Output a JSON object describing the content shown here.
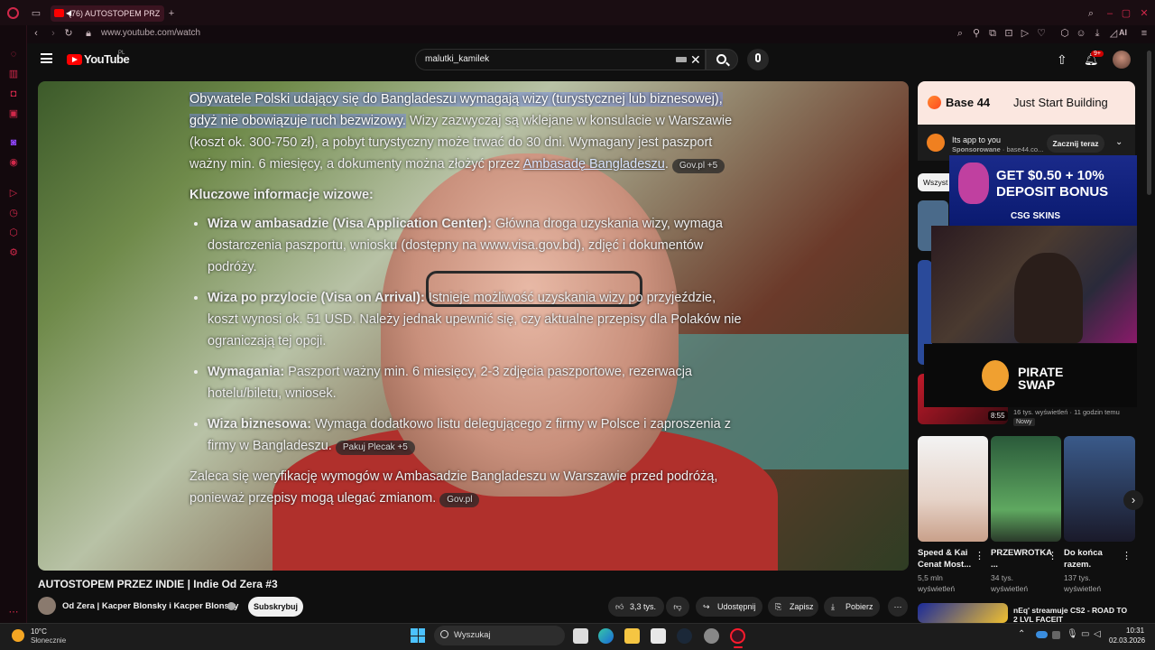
{
  "browser": {
    "tab_title": "(76) AUTOSTOPEM PRZ",
    "url": "www.youtube.com/watch",
    "ai_label": "AI"
  },
  "youtube": {
    "logo": "YouTube",
    "logo_country": "PL",
    "search_value": "malutki_kamilek",
    "notification_badge": "9+"
  },
  "video": {
    "overlay": {
      "intro_highlight": "Obywatele Polski udający się do Bangladeszu wymagają wizy (turystycznej lub biznesowej), gdyż nie obowiązuje ruch bezwizowy.",
      "intro_rest": " Wizy zazwyczaj są wklejane w konsulacie w Warszawie (koszt ok. 300-750 zł), a pobyt turystyczny może trwać do 30 dni. Wymagany jest paszport ważny min. 6 miesięcy, a dokumenty można złożyć przez ",
      "intro_link": "Ambasadę Bangladeszu",
      "intro_chip": "Gov.pl +5",
      "heading": "Kluczowe informacje wizowe:",
      "items": [
        {
          "title": "Wiza w ambasadzie (Visa Application Center):",
          "text": " Główna droga uzyskania wizy, wymaga dostarczenia paszportu, wniosku (dostępny na www.visa.gov.bd), zdjęć i dokumentów podróży.",
          "chip": ""
        },
        {
          "title": "Wiza po przylocie (Visa on Arrival):",
          "text": " Istnieje możliwość uzyskania wizy po przyjeździe, koszt wynosi ok. 51 USD. Należy jednak upewnić się, czy aktualne przepisy dla Polaków nie ograniczają tej opcji.",
          "chip": ""
        },
        {
          "title": "Wymagania:",
          "text": " Paszport ważny min. 6 miesięcy, 2-3 zdjęcia paszportowe, rezerwacja hotelu/biletu, wniosek.",
          "chip": ""
        },
        {
          "title": "Wiza biznesowa:",
          "text": " Wymaga dodatkowo listu delegującego z firmy w Polsce i zaproszenia z firmy w Bangladeszu.",
          "chip": "Pakuj Plecak +5"
        }
      ],
      "outro": "Zaleca się weryfikację wymogów w Ambasadzie Bangladeszu w Warszawie przed podróżą, ponieważ przepisy mogą ulegać zmianom.",
      "outro_chip": "Gov.pl"
    },
    "title": "AUTOSTOPEM PRZEZ INDIE | Indie Od Zera #3",
    "channel": "Od Zera | Kacper Blonsky i Kacper Blonsky",
    "subscribe_label": "Subskrybuj",
    "like_count": "3,3 tys.",
    "share_label": "Udostępnij",
    "save_label": "Zapisz",
    "download_label": "Pobierz"
  },
  "sidebar": {
    "ad": {
      "brand": "Base 44",
      "tagline": "Just Start Building",
      "line1": "Its app to you",
      "sponsored": "Sponsorowane",
      "domain": "base44.co...",
      "cta": "Zacznij teraz"
    },
    "chip_all": "Wszyst",
    "csg": {
      "line1": "GET $0.50 + 10%",
      "line2": "DEPOSIT BONUS",
      "brand": "CSG SKINS"
    },
    "pirate": "PIRATE SWAP",
    "video_meta": {
      "duration": "8:55",
      "views": "16 tys. wyświetleń · 11 godzin temu",
      "badge": "Nowy"
    },
    "shorts": [
      {
        "title": "Speed & Kai Cenat Most...",
        "views": "5,5 mln wyświetleń"
      },
      {
        "title": "PRZEWROTKA ...",
        "views": "34 tys. wyświetleń"
      },
      {
        "title": "Do końca razem.",
        "views": "137 tys. wyświetleń"
      }
    ],
    "next_video": "nEq' streamuje CS2 - ROAD TO 2 LVL FACEIT"
  },
  "taskbar": {
    "weather_temp": "10°C",
    "weather_desc": "Słonecznie",
    "search_placeholder": "Wyszukaj",
    "time": "10:31",
    "date": "02.03.2026"
  },
  "colors": {
    "accent": "#d0284a",
    "yt_red": "#ff0000"
  }
}
